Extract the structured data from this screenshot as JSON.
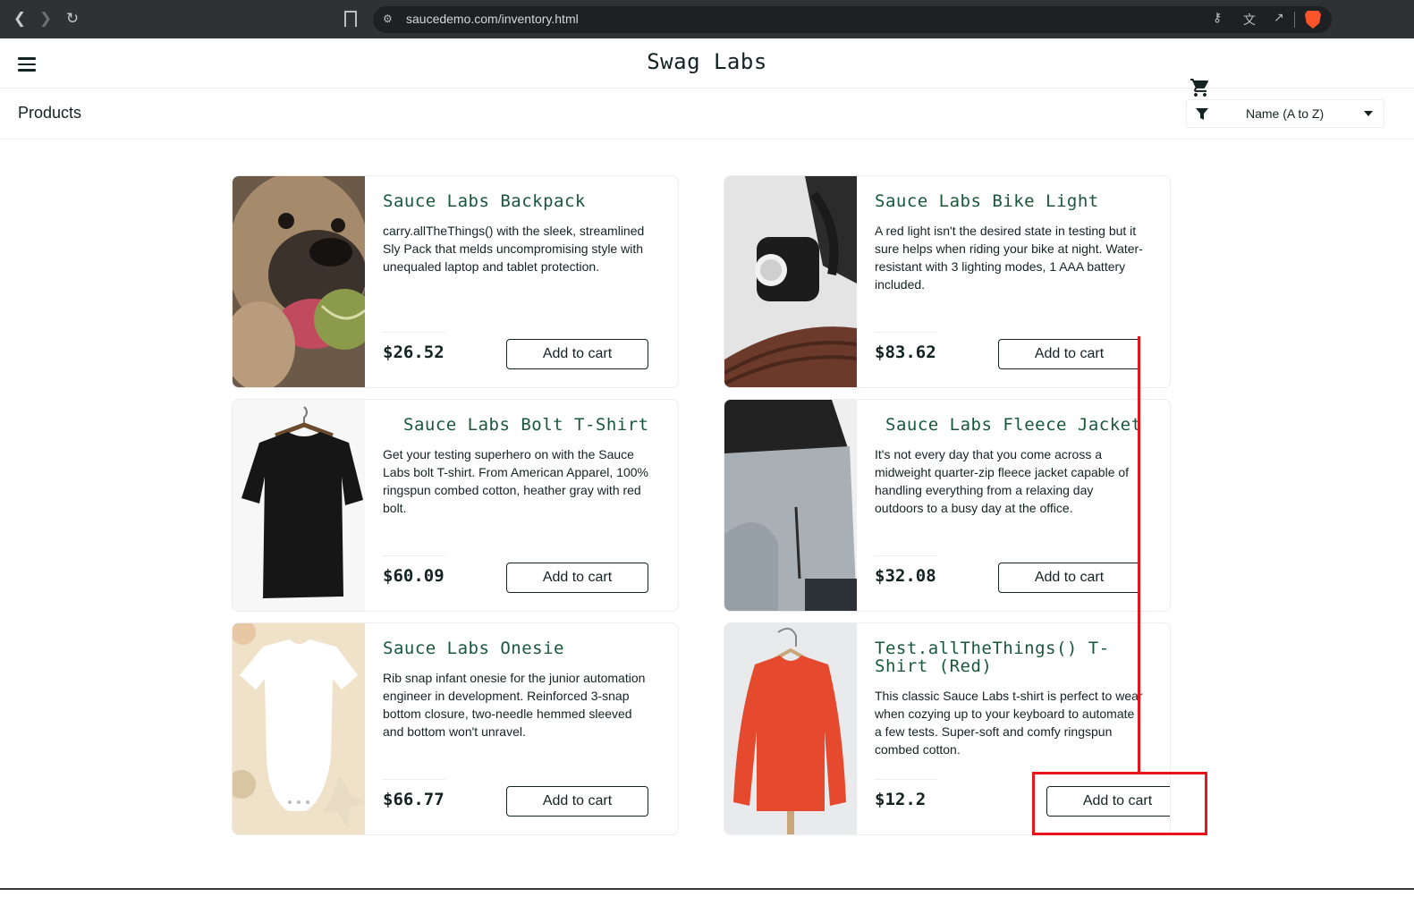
{
  "browser": {
    "url": "saucedemo.com/inventory.html"
  },
  "header": {
    "logo": "Swag Labs"
  },
  "subheader": {
    "title": "Products",
    "sort_selected": "Name (A to Z)"
  },
  "items": [
    {
      "name": "Sauce Labs Backpack",
      "desc": "carry.allTheThings() with the sleek, streamlined Sly Pack that melds uncompromising style with unequaled laptop and tablet protection.",
      "price": "$26.52",
      "button": "Add to cart"
    },
    {
      "name": "Sauce Labs Bike Light",
      "desc": "A red light isn't the desired state in testing but it sure helps when riding your bike at night. Water-resistant with 3 lighting modes, 1 AAA battery included.",
      "price": "$83.62",
      "button": "Add to cart"
    },
    {
      "name": "Sauce Labs Bolt T-Shirt",
      "desc": "Get your testing superhero on with the Sauce Labs bolt T-shirt. From American Apparel, 100% ringspun combed cotton, heather gray with red bolt.",
      "price": "$60.09",
      "button": "Add to cart"
    },
    {
      "name": "Sauce Labs Fleece Jacket",
      "desc": "It's not every day that you come across a midweight quarter-zip fleece jacket capable of handling everything from a relaxing day outdoors to a busy day at the office.",
      "price": "$32.08",
      "button": "Add to cart"
    },
    {
      "name": "Sauce Labs Onesie",
      "desc": "Rib snap infant onesie for the junior automation engineer in development. Reinforced 3-snap bottom closure, two-needle hemmed sleeved and bottom won't unravel.",
      "price": "$66.77",
      "button": "Add to cart"
    },
    {
      "name": "Test.allTheThings() T-Shirt (Red)",
      "desc": "This classic Sauce Labs t-shirt is perfect to wear when cozying up to your keyboard to automate a few tests. Super-soft and comfy ringspun combed cotton.",
      "price": "$12.2",
      "button": "Add to cart"
    }
  ],
  "colors": {
    "item_name": "#18583a",
    "annotation": "#e8141a"
  }
}
